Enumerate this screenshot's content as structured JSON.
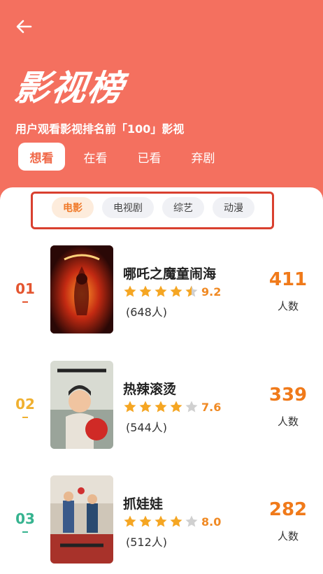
{
  "header": {
    "title": "影视榜",
    "subtitle": "用户观看影视排名前「100」影视",
    "tabs": [
      {
        "label": "想看",
        "active": true
      },
      {
        "label": "在看",
        "active": false
      },
      {
        "label": "已看",
        "active": false
      },
      {
        "label": "弃剧",
        "active": false
      }
    ]
  },
  "filters": [
    {
      "label": "电影",
      "active": true
    },
    {
      "label": "电视剧",
      "active": false
    },
    {
      "label": "综艺",
      "active": false
    },
    {
      "label": "动漫",
      "active": false
    }
  ],
  "colors": {
    "header_bg": "#f4705f",
    "accent_orange": "#f07a1a",
    "star": "#f5a623",
    "star_empty": "#d0d0d0",
    "rank1": "#e4552f",
    "rank2": "#f0b030",
    "rank3": "#36b38f"
  },
  "count_unit": "人数",
  "items": [
    {
      "rank": "01",
      "title": "哪吒之魔童闹海",
      "score": "9.2",
      "stars": 4.5,
      "people": "(648人)",
      "count": "411"
    },
    {
      "rank": "02",
      "title": "热辣滚烫",
      "score": "7.6",
      "stars": 4,
      "people": "(544人)",
      "count": "339"
    },
    {
      "rank": "03",
      "title": "抓娃娃",
      "score": "8.0",
      "stars": 4,
      "people": "(512人)",
      "count": "282"
    }
  ]
}
